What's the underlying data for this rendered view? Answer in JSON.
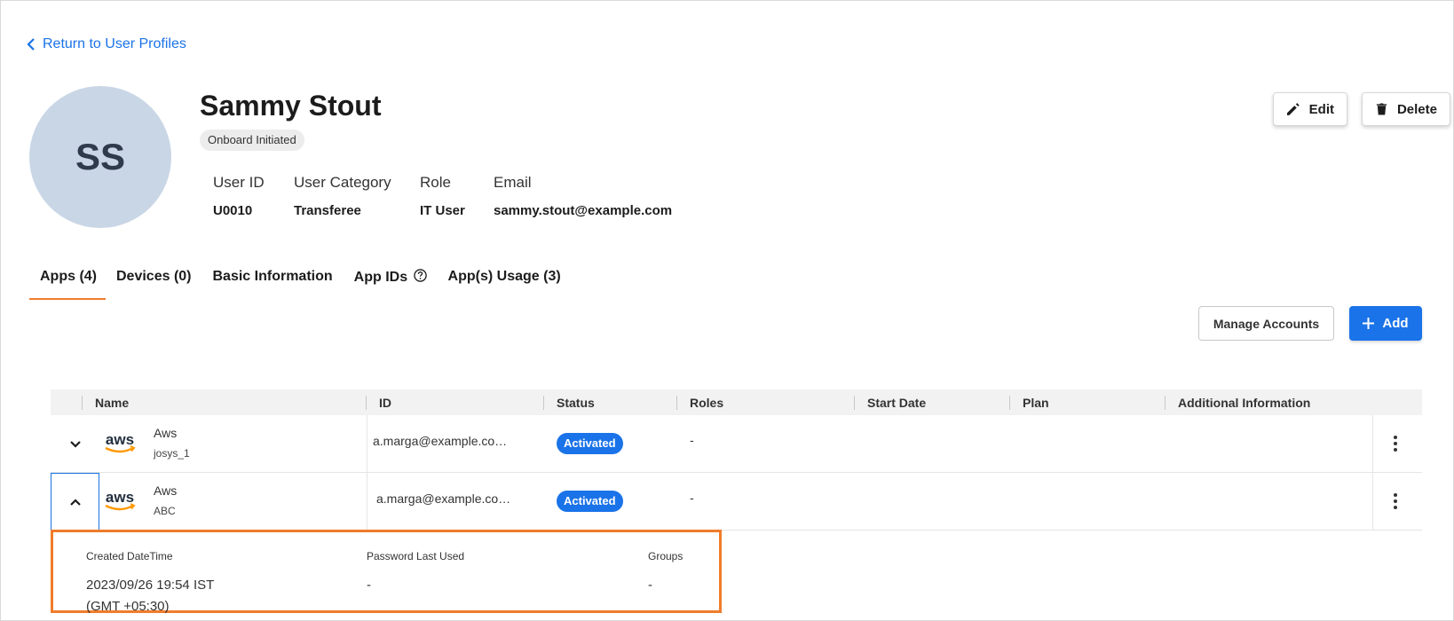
{
  "nav": {
    "back_label": "Return to User Profiles"
  },
  "profile": {
    "initials": "SS",
    "name": "Sammy Stout",
    "status": "Onboard Initiated",
    "fields": [
      {
        "label": "User ID",
        "value": "U0010"
      },
      {
        "label": "User Category",
        "value": "Transferee"
      },
      {
        "label": "Role",
        "value": "IT User"
      },
      {
        "label": "Email",
        "value": "sammy.stout@example.com"
      }
    ]
  },
  "actions": {
    "edit_label": "Edit",
    "delete_label": "Delete"
  },
  "tabs": [
    {
      "label": "Apps (4)",
      "active": true
    },
    {
      "label": "Devices (0)",
      "active": false
    },
    {
      "label": "Basic Information",
      "active": false
    },
    {
      "label": "App IDs",
      "active": false
    },
    {
      "label": "App(s) Usage (3)",
      "active": false
    }
  ],
  "toolbar": {
    "manage_label": "Manage Accounts",
    "add_label": "Add"
  },
  "table": {
    "headers": [
      "Name",
      "ID",
      "Status",
      "Roles",
      "Start Date",
      "Plan",
      "Additional Information"
    ],
    "rows": [
      {
        "logo": "aws",
        "name": "Aws",
        "sub": "josys_1",
        "id": "a.marga@example.co…",
        "status": "Activated",
        "roles": "-",
        "expanded": false
      },
      {
        "logo": "aws",
        "name": "Aws",
        "sub": "ABC",
        "id": "a.marga@example.co…",
        "status": "Activated",
        "roles": "-",
        "expanded": true
      }
    ],
    "detail": {
      "created_label": "Created DateTime",
      "created_value": "2023/09/26 19:54 IST",
      "created_tz": "(GMT +05:30)",
      "password_label": "Password Last Used",
      "password_value": "-",
      "groups_label": "Groups",
      "groups_value": "-"
    }
  },
  "colors": {
    "accent": "#1a73e8",
    "tab_underline": "#f07c2b",
    "highlight": "#f07c2b",
    "avatar_bg": "#c9d6e6",
    "aws_orange": "#ff9900"
  }
}
